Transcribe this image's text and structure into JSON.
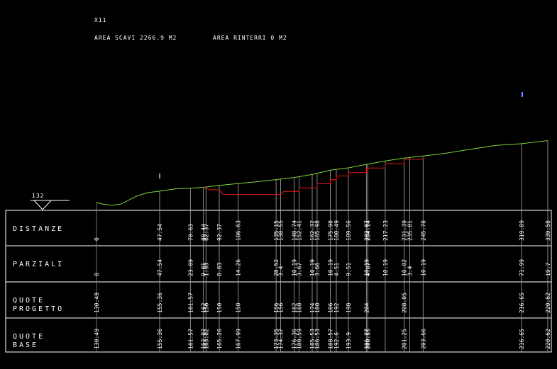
{
  "header": {
    "section_name": "X11",
    "area_scavi": "AREA SCAVI 2266.9 M2",
    "area_rinterri": "AREA RINTERRI 0 M2"
  },
  "datum": {
    "value": "132"
  },
  "rows": {
    "distanze": "DISTANZE",
    "parziali": "PARZIALI",
    "quote_progetto": [
      "QUOTE",
      "PROGETTO"
    ],
    "quote_base": [
      "QUOTE",
      "BASE"
    ]
  },
  "colors": {
    "background": "#000000",
    "table_lines": "#ffffff",
    "ground_profile": "#7fd63a",
    "project_profile": "#e01b1b",
    "marker": "#7b8cff"
  },
  "chart_data": {
    "type": "profile",
    "distanze": [
      "0",
      "47.54",
      "70.63",
      "80.44",
      "82.37",
      "92.37",
      "106.63",
      "135.15",
      "138.55",
      "148.74",
      "152.41",
      "162.32",
      "165.98",
      "175.98",
      "180.49",
      "189.56",
      "203.07",
      "204.14",
      "217.23",
      "231.39",
      "235.81",
      "245.78",
      "319.89",
      "339.58"
    ],
    "parziali": [
      "0",
      "47.54",
      "23.09",
      "9.81",
      "1.93",
      "8.83",
      "14.26",
      "28.52",
      "3.4",
      "10.19",
      "3.67",
      "10.19",
      "3.66",
      "10.19",
      "4.51",
      "9.51",
      "10.19",
      "4.07",
      "10.19",
      "10.82",
      "3.4",
      "10.19",
      "71.99",
      "19.7"
    ],
    "quote_progetto": [
      "130.49",
      "155.36",
      "161.57",
      "162",
      "156",
      "150",
      "150",
      "156",
      "156",
      "162",
      "168",
      "174",
      "180",
      "186",
      "192",
      "198",
      "204",
      "208.05",
      "216.65",
      "220.62"
    ],
    "quote_base": [
      "130.49",
      "155.36",
      "161.57",
      "162.07",
      "163.82",
      "165.26",
      "167.99",
      "173.35",
      "174.37",
      "176.36",
      "180.59",
      "185.53",
      "186.53",
      "188.57",
      "192.6",
      "193.9",
      "196.27",
      "200.55",
      "201.25",
      "203.66",
      "216.65",
      "220.62"
    ]
  }
}
